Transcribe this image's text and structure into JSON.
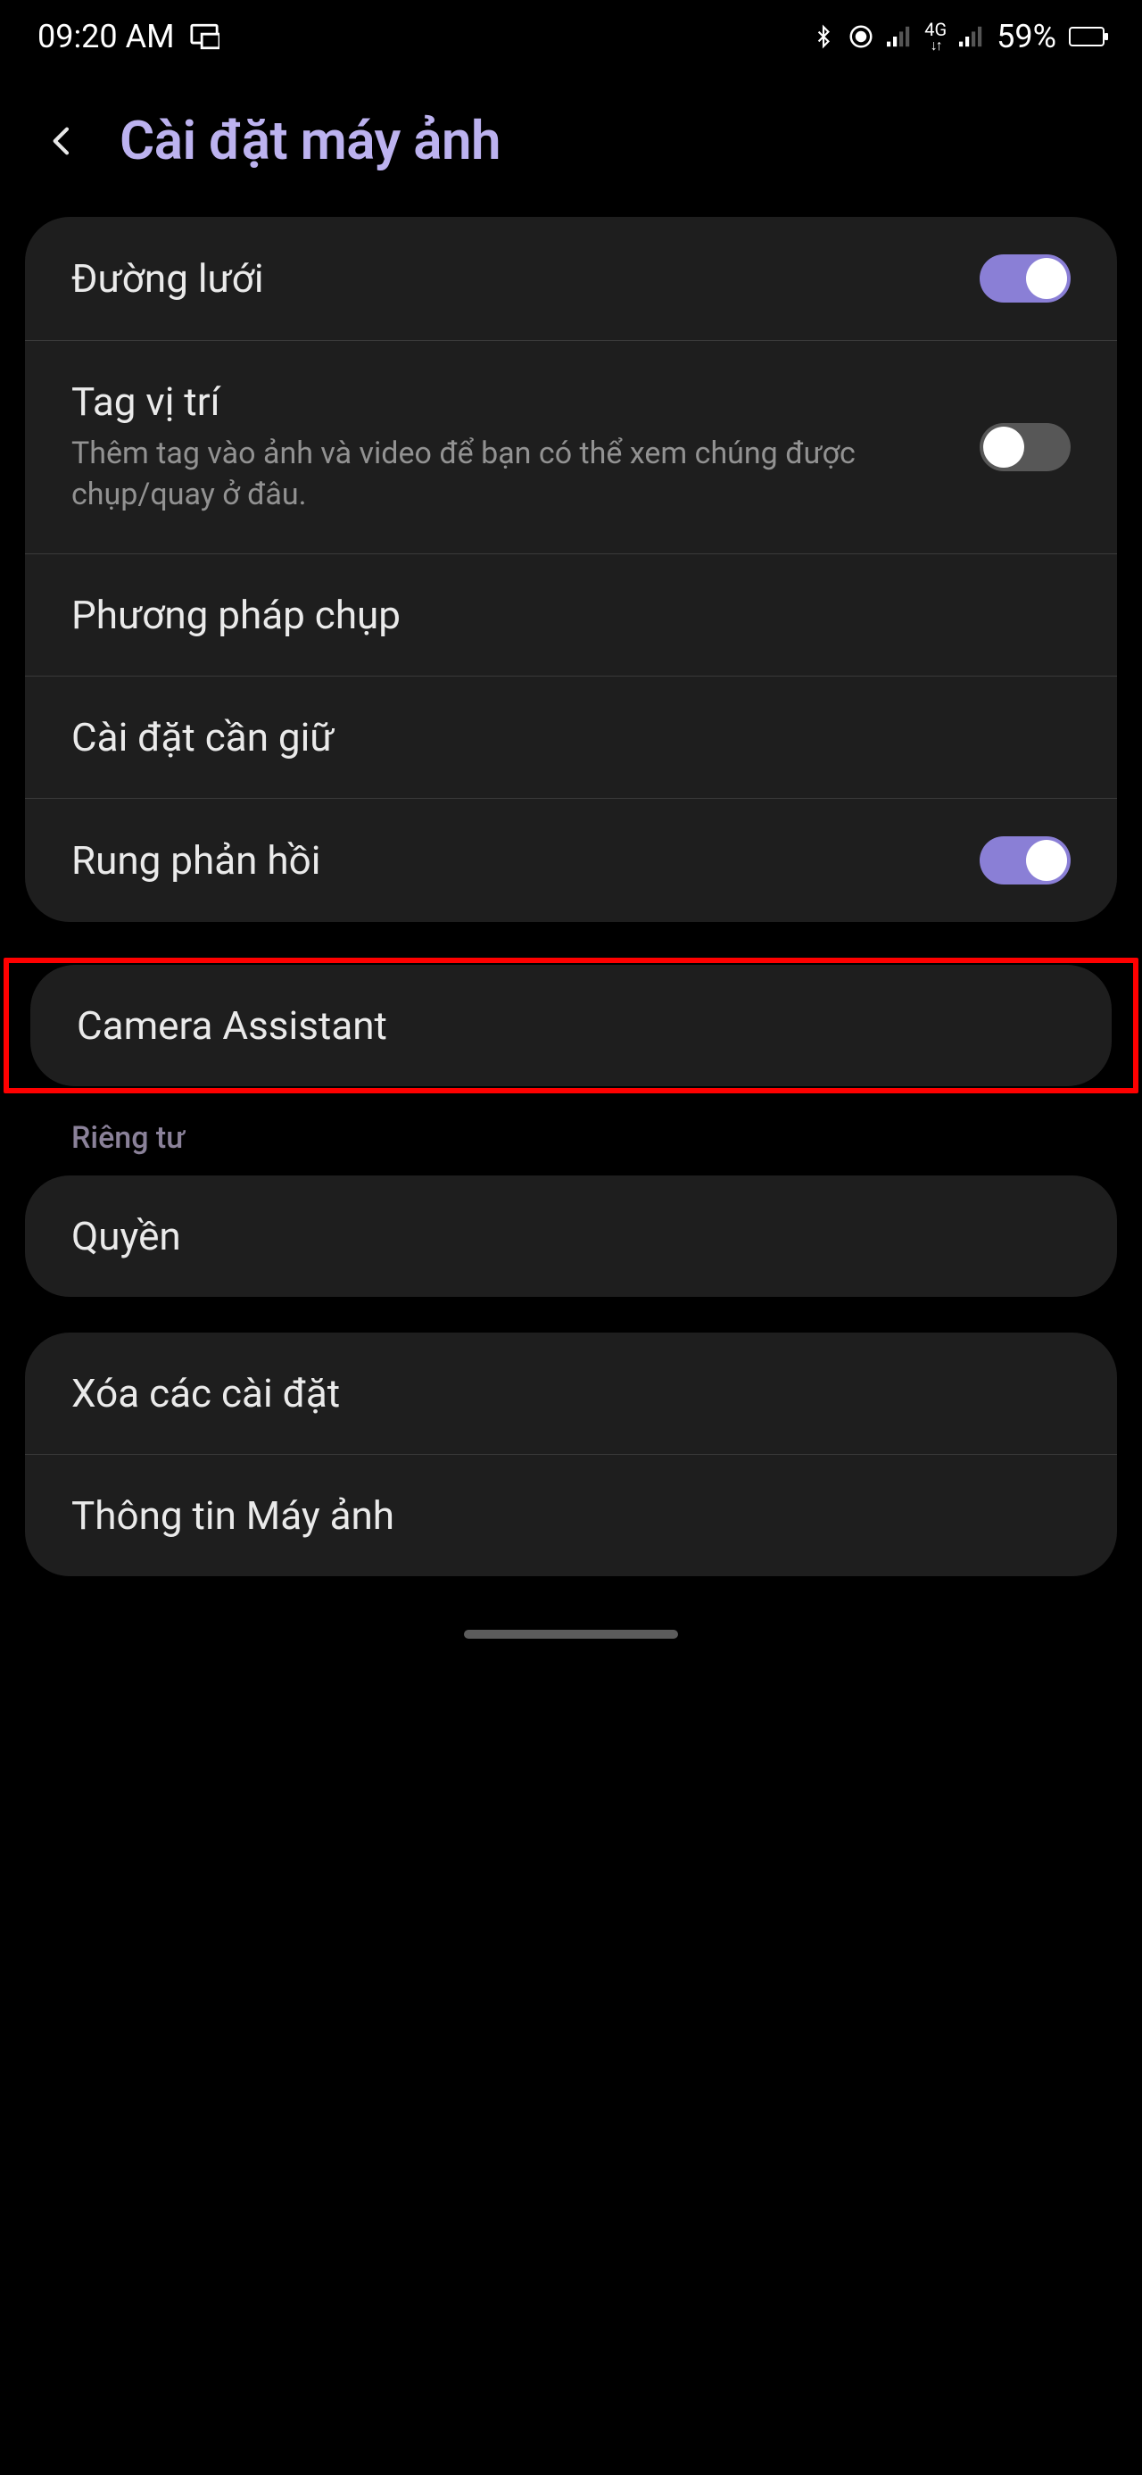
{
  "status": {
    "time": "09:20 AM",
    "network_type": "4G",
    "battery_percent": "59%"
  },
  "header": {
    "title": "Cài đặt máy ảnh"
  },
  "group1": {
    "grid_lines": {
      "label": "Đường lưới",
      "on": true
    },
    "location_tag": {
      "label": "Tag vị trí",
      "desc": "Thêm tag vào ảnh và video để bạn có thể xem chúng được chụp/quay ở đâu.",
      "on": false
    },
    "shooting_methods": {
      "label": "Phương pháp chụp"
    },
    "settings_to_keep": {
      "label": "Cài đặt cần giữ"
    },
    "vibration_feedback": {
      "label": "Rung phản hồi",
      "on": true
    }
  },
  "group2": {
    "camera_assistant": {
      "label": "Camera Assistant"
    }
  },
  "privacy_heading": "Riêng tư",
  "group3": {
    "permissions": {
      "label": "Quyền"
    }
  },
  "group4": {
    "reset_settings": {
      "label": "Xóa các cài đặt"
    },
    "about_camera": {
      "label": "Thông tin Máy ảnh"
    }
  }
}
